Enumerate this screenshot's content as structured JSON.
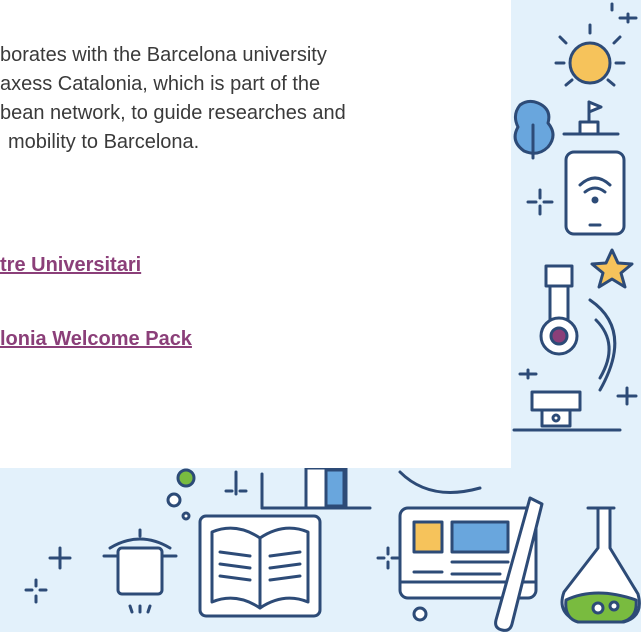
{
  "content": {
    "intro_lines": [
      "borates with the Barcelona university",
      "axess Catalonia, which is part of the",
      "bean network, to guide researches and",
      "mobility to Barcelona."
    ],
    "links": [
      "tre Universitari",
      "lonia Welcome Pack"
    ]
  },
  "colors": {
    "text": "#3a3a3a",
    "link": "#8b3f79",
    "background_art": "#e3f1fb",
    "line_art": "#2d4b77",
    "accent_orange": "#f6c35b",
    "accent_blue": "#69a6dd",
    "accent_green": "#79bb3f",
    "accent_purple": "#8b3f79"
  },
  "icons": [
    "sun-icon",
    "tree-icon",
    "flag-icon",
    "tablet-wifi-icon",
    "star-icon",
    "microscope-icon",
    "sparkle-icon",
    "cooking-pot-icon",
    "open-book-icon",
    "computer-monitor-icon",
    "flask-icon",
    "test-tube-icon",
    "lamp-icon"
  ]
}
